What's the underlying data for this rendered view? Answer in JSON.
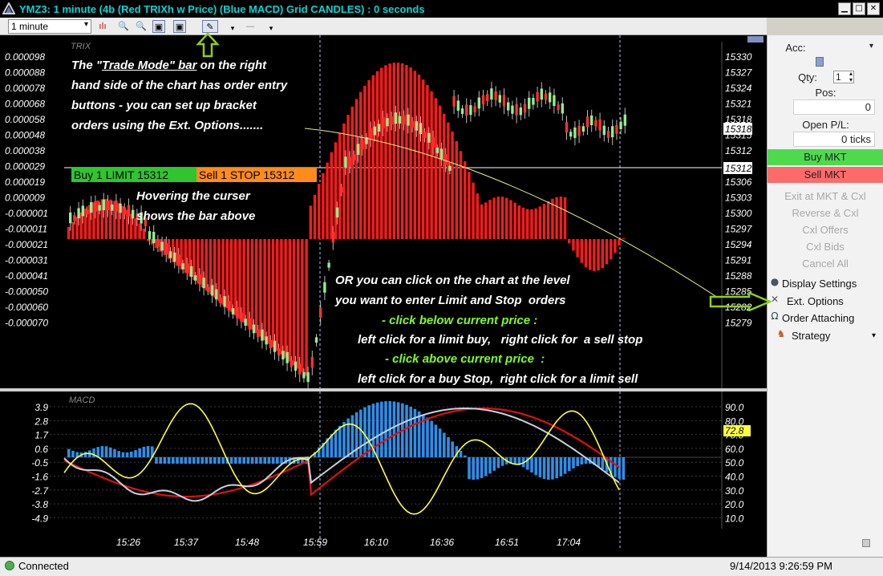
{
  "window": {
    "title": "YMZ3: 1 minute (4b (Red TRIXh w Price) (Blue MACD)  Grid CANDLES) : 0 seconds",
    "minimize_glyph": "▁",
    "maximize_glyph": "□",
    "close_glyph": "✕"
  },
  "toolbar": {
    "timeframe": "1 minute",
    "icons": [
      "bar-style-icon",
      "zoom-in-icon",
      "zoom-out-icon",
      "screen-icon",
      "screen2-icon",
      "trade-mode-icon",
      "dropdown-icon",
      "draw-line-icon",
      "dropdown2-icon"
    ]
  },
  "chart": {
    "upper_panel_label": "TRIX",
    "lower_panel_label": "MACD",
    "trix_scale": [
      "0.000098",
      "0.000088",
      "0.000078",
      "0.000068",
      "0.000058",
      "0.000048",
      "0.000038",
      "0.000029",
      "0.000019",
      "0.000009",
      "-0.000001",
      "-0.000011",
      "-0.000021",
      "-0.000031",
      "-0.000041",
      "-0.000050",
      "-0.000060",
      "-0.000070"
    ],
    "price_scale": [
      "15330",
      "15327",
      "15324",
      "15321",
      "15318",
      "15315",
      "15312",
      "15309",
      "15306",
      "15303",
      "15300",
      "15297",
      "15294",
      "15291",
      "15288",
      "15285",
      "15282",
      "15279"
    ],
    "current_price_tag": "15318",
    "order_price_tag": "15312",
    "macd_scale": [
      "3.9",
      "2.8",
      "1.7",
      "0.6",
      "-0.5",
      "-1.6",
      "-2.7",
      "-3.8",
      "-4.9"
    ],
    "osc_scale": [
      "90.0",
      "80.0",
      "70.0",
      "60.0",
      "50.0",
      "40.0",
      "30.0",
      "20.0",
      "10.0"
    ],
    "osc_value_tag": "72.8",
    "time_labels": [
      "15:26",
      "15:37",
      "15:48",
      "15:59",
      "16:10",
      "16:36",
      "16:51",
      "17:04"
    ],
    "colors": {
      "trix": "#ff1a1a",
      "candle_up": "#90ee90",
      "candle_down": "#ff3030",
      "macd_hist": "#2e8ee8",
      "signal_yellow": "#ffff40",
      "signal_red": "#e01010",
      "signal_grey": "#c8d0e0",
      "accent_green": "#80ff20"
    }
  },
  "annotations": {
    "trade_mode_1": "The \"",
    "trade_mode_u": "Trade Mode\" bar",
    "trade_mode_2": " on the right",
    "line2": "hand side of the chart has order entry",
    "line3": "buttons - you can set up bracket",
    "line4": "orders using the Ext. Options.......",
    "hover1": "Hovering the curser",
    "hover2": "shows the bar above",
    "or1": "OR you can click on the chart at the level",
    "or2": "you want to enter Limit and Stop  orders",
    "below_hdr": "- click below current price :",
    "below_txt": "left click for a limit buy,   right click for  a sell stop",
    "above_hdr": "- click above current price  :",
    "above_txt": "left click for a buy Stop,  right click for a limit sell"
  },
  "orders": {
    "buy_limit": "Buy 1 LIMIT 15312",
    "sell_stop": "Sell 1 STOP 15312"
  },
  "sidebar": {
    "acc_label": "Acc:",
    "qty_label": "Qty:",
    "qty_value": "1",
    "pos_label": "Pos:",
    "pos_value": "0",
    "pl_label": "Open P/L:",
    "pl_value": "0 ticks",
    "buy_mkt": "Buy MKT",
    "sell_mkt": "Sell MKT",
    "exit_mkt": "Exit at MKT & Cxl",
    "reverse": "Reverse & Cxl",
    "cxl_offers": "Cxl Offers",
    "cxl_bids": "Cxl Bids",
    "cancel_all": "Cancel All",
    "display_settings": "Display Settings",
    "ext_options": "Ext. Options",
    "order_attaching": "Order Attaching",
    "strategy": "Strategy"
  },
  "status": {
    "connection": "Connected",
    "datetime": "9/14/2013 9:26:59 PM"
  }
}
